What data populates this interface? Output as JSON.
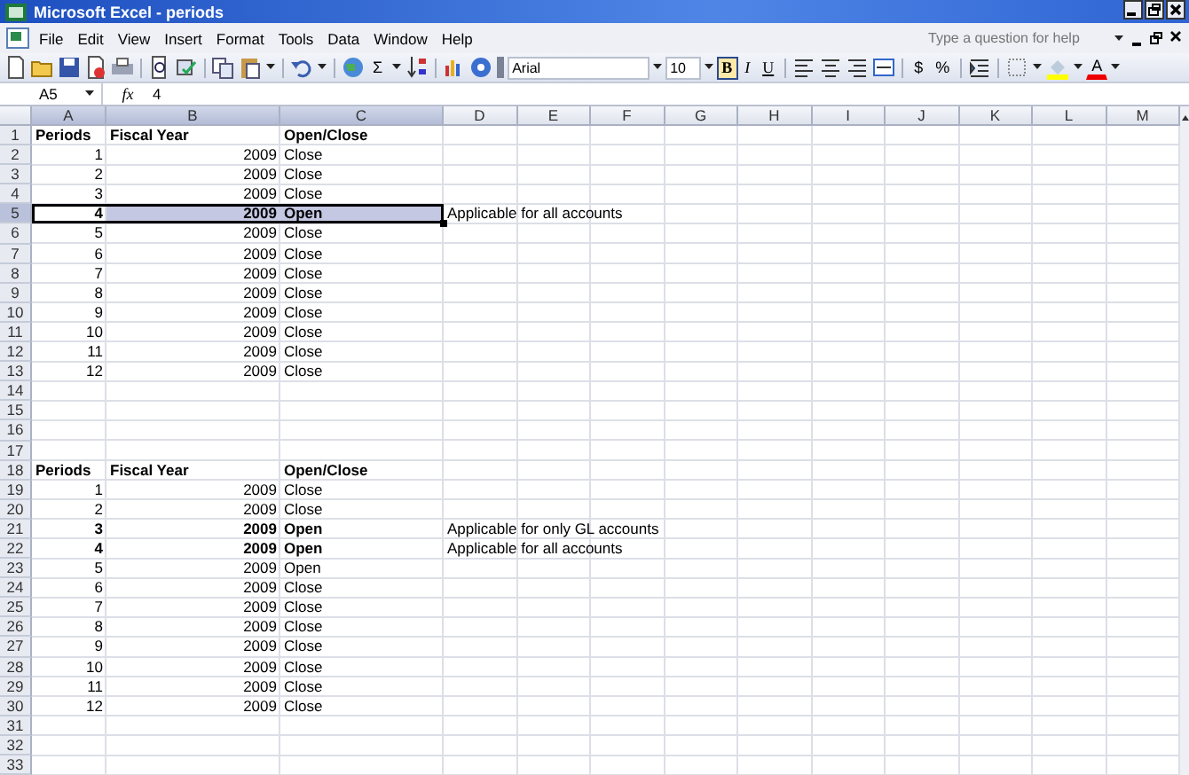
{
  "window": {
    "title": "Microsoft Excel - periods"
  },
  "menu": [
    {
      "label": "File"
    },
    {
      "label": "Edit"
    },
    {
      "label": "View"
    },
    {
      "label": "Insert"
    },
    {
      "label": "Format"
    },
    {
      "label": "Tools"
    },
    {
      "label": "Data"
    },
    {
      "label": "Window"
    },
    {
      "label": "Help"
    }
  ],
  "help_box": {
    "placeholder": "Type a question for help"
  },
  "standard_toolbar": {
    "autosum": "Σ"
  },
  "formatting_toolbar": {
    "font": "Arial",
    "size": "10",
    "bold": "B",
    "bold_active": true,
    "italic": "I",
    "underline": "U",
    "currency": "$",
    "percent": "%",
    "font_color": "A"
  },
  "formula_bar": {
    "name_box": "A5",
    "fx": "fx",
    "value": "4"
  },
  "columns": [
    {
      "label": "A",
      "selected": true
    },
    {
      "label": "B",
      "selected": true
    },
    {
      "label": "C",
      "selected": true
    },
    {
      "label": "D",
      "selected": false
    },
    {
      "label": "E",
      "selected": false
    },
    {
      "label": "F",
      "selected": false
    },
    {
      "label": "G",
      "selected": false
    },
    {
      "label": "H",
      "selected": false
    },
    {
      "label": "I",
      "selected": false
    },
    {
      "label": "J",
      "selected": false
    },
    {
      "label": "K",
      "selected": false
    },
    {
      "label": "L",
      "selected": false
    },
    {
      "label": "M",
      "selected": false
    }
  ],
  "rows": [
    {
      "n": "1",
      "kind": "header",
      "bold": true,
      "selected": false,
      "a": "Periods",
      "b": "Fiscal Year",
      "c": "Open/Close"
    },
    {
      "n": "2",
      "kind": "data",
      "bold": false,
      "selected": false,
      "a": "1",
      "b": "2009",
      "c": "Close"
    },
    {
      "n": "3",
      "kind": "data",
      "bold": false,
      "selected": false,
      "a": "2",
      "b": "2009",
      "c": "Close"
    },
    {
      "n": "4",
      "kind": "data",
      "bold": false,
      "selected": false,
      "a": "3",
      "b": "2009",
      "c": "Close"
    },
    {
      "n": "5",
      "kind": "data",
      "bold": true,
      "selected": true,
      "a": "4",
      "b": "2009",
      "c": "Open",
      "d": "Applicable for all accounts"
    },
    {
      "n": "6",
      "kind": "data",
      "bold": false,
      "selected": false,
      "a": "5",
      "b": "2009",
      "c": "Close"
    },
    {
      "n": "7",
      "kind": "data",
      "bold": false,
      "selected": false,
      "a": "6",
      "b": "2009",
      "c": "Close"
    },
    {
      "n": "8",
      "kind": "data",
      "bold": false,
      "selected": false,
      "a": "7",
      "b": "2009",
      "c": "Close"
    },
    {
      "n": "9",
      "kind": "data",
      "bold": false,
      "selected": false,
      "a": "8",
      "b": "2009",
      "c": "Close"
    },
    {
      "n": "10",
      "kind": "data",
      "bold": false,
      "selected": false,
      "a": "9",
      "b": "2009",
      "c": "Close"
    },
    {
      "n": "11",
      "kind": "data",
      "bold": false,
      "selected": false,
      "a": "10",
      "b": "2009",
      "c": "Close"
    },
    {
      "n": "12",
      "kind": "data",
      "bold": false,
      "selected": false,
      "a": "11",
      "b": "2009",
      "c": "Close"
    },
    {
      "n": "13",
      "kind": "data",
      "bold": false,
      "selected": false,
      "a": "12",
      "b": "2009",
      "c": "Close"
    },
    {
      "n": "14",
      "kind": "blank",
      "selected": false
    },
    {
      "n": "15",
      "kind": "blank",
      "selected": false
    },
    {
      "n": "16",
      "kind": "blank",
      "selected": false
    },
    {
      "n": "17",
      "kind": "blank",
      "selected": false
    },
    {
      "n": "18",
      "kind": "header",
      "bold": true,
      "selected": false,
      "a": "Periods",
      "b": "Fiscal Year",
      "c": "Open/Close"
    },
    {
      "n": "19",
      "kind": "data",
      "bold": false,
      "selected": false,
      "a": "1",
      "b": "2009",
      "c": "Close"
    },
    {
      "n": "20",
      "kind": "data",
      "bold": false,
      "selected": false,
      "a": "2",
      "b": "2009",
      "c": "Close"
    },
    {
      "n": "21",
      "kind": "data",
      "bold": true,
      "selected": false,
      "a": "3",
      "b": "2009",
      "c": "Open",
      "d": "Applicable for only GL accounts"
    },
    {
      "n": "22",
      "kind": "data",
      "bold": true,
      "selected": false,
      "a": "4",
      "b": "2009",
      "c": "Open",
      "d": "Applicable for all accounts"
    },
    {
      "n": "23",
      "kind": "data",
      "bold": false,
      "selected": false,
      "a": "5",
      "b": "2009",
      "c": "Open"
    },
    {
      "n": "24",
      "kind": "data",
      "bold": false,
      "selected": false,
      "a": "6",
      "b": "2009",
      "c": "Close"
    },
    {
      "n": "25",
      "kind": "data",
      "bold": false,
      "selected": false,
      "a": "7",
      "b": "2009",
      "c": "Close"
    },
    {
      "n": "26",
      "kind": "data",
      "bold": false,
      "selected": false,
      "a": "8",
      "b": "2009",
      "c": "Close"
    },
    {
      "n": "27",
      "kind": "data",
      "bold": false,
      "selected": false,
      "a": "9",
      "b": "2009",
      "c": "Close"
    },
    {
      "n": "28",
      "kind": "data",
      "bold": false,
      "selected": false,
      "a": "10",
      "b": "2009",
      "c": "Close"
    },
    {
      "n": "29",
      "kind": "data",
      "bold": false,
      "selected": false,
      "a": "11",
      "b": "2009",
      "c": "Close"
    },
    {
      "n": "30",
      "kind": "data",
      "bold": false,
      "selected": false,
      "a": "12",
      "b": "2009",
      "c": "Close"
    },
    {
      "n": "31",
      "kind": "blank",
      "selected": false
    },
    {
      "n": "32",
      "kind": "blank",
      "selected": false
    },
    {
      "n": "33",
      "kind": "blank",
      "selected": false
    }
  ]
}
